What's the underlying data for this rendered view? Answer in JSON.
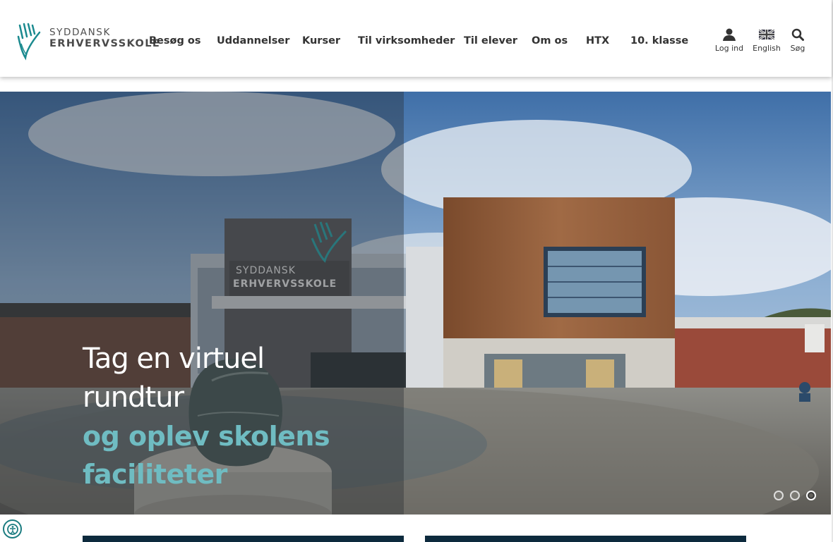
{
  "header": {
    "logo": {
      "line1": "SYDDANSK",
      "line2": "ERHVERVSSKOLE",
      "icon": "hand-check-logo-icon"
    },
    "nav": [
      {
        "label": "Besøg os"
      },
      {
        "label": "Uddannelser"
      },
      {
        "label": "Kurser"
      },
      {
        "label": "Til virksomheder"
      },
      {
        "label": "Til elever"
      },
      {
        "label": "Om os"
      },
      {
        "label": "HTX"
      },
      {
        "label": "10. klasse"
      }
    ],
    "utilities": {
      "login": {
        "label": "Log ind",
        "icon": "user-icon"
      },
      "english": {
        "label": "English",
        "icon": "uk-flag-icon"
      },
      "search": {
        "label": "Søg",
        "icon": "search-icon"
      }
    }
  },
  "hero": {
    "line1": "Tag en virtuel",
    "line2": "rundtur",
    "line3": "og oplev skolens",
    "line4": "faciliteter",
    "building_sign_line1": "SYDDANSK",
    "building_sign_line2": "ERHVERVSSKOLE",
    "slides_total": 3,
    "active_slide": 3
  },
  "colors": {
    "accent_teal": "#6fbcc2",
    "logo_teal": "#1b8a8f",
    "nav_text": "#333333",
    "card_navy": "#0d2a3d"
  },
  "accessibility": {
    "icon": "accessibility-icon"
  }
}
